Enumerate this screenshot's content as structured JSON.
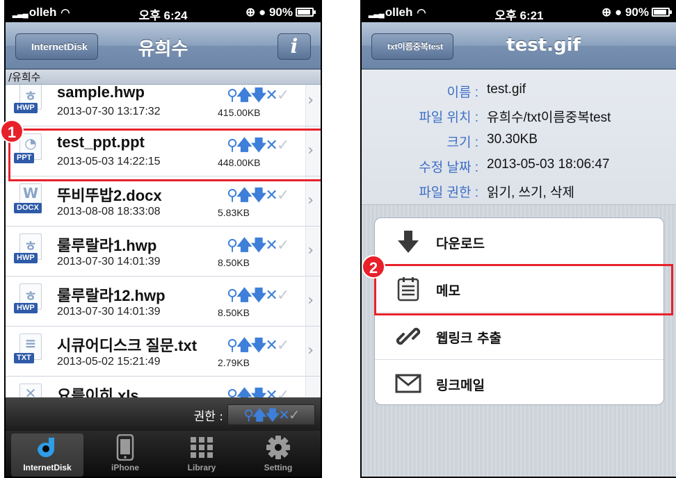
{
  "left": {
    "status": {
      "carrier": "olleh",
      "time": "오후 6:24",
      "battery": "90%"
    },
    "nav": {
      "back": "InternetDisk",
      "title": "유희수",
      "info": "i"
    },
    "path": "/유희수",
    "files": [
      {
        "name": "sample.hwp",
        "date": "2013-07-30 13:17:32",
        "size": "415.00KB",
        "type": "HWP",
        "icon": "hwp-file-icon"
      },
      {
        "name": "test_ppt.ppt",
        "date": "2013-05-03 14:22:15",
        "size": "448.00KB",
        "type": "PPT",
        "icon": "ppt-file-icon"
      },
      {
        "name": "뚜비뚜밥2.docx",
        "date": "2013-08-08 18:33:08",
        "size": "5.83KB",
        "type": "DOCX",
        "icon": "docx-file-icon"
      },
      {
        "name": "룰루랄라1.hwp",
        "date": "2013-07-30 14:01:39",
        "size": "8.50KB",
        "type": "HWP",
        "icon": "hwp-file-icon"
      },
      {
        "name": "룰루랄라12.hwp",
        "date": "2013-07-30 14:01:39",
        "size": "8.50KB",
        "type": "HWP",
        "icon": "hwp-file-icon"
      },
      {
        "name": "시큐어디스크 질문.txt",
        "date": "2013-05-02 15:21:49",
        "size": "2.79KB",
        "type": "TXT",
        "icon": "txt-file-icon"
      },
      {
        "name": "요를이히.xls",
        "date": "",
        "size": "",
        "type": "",
        "icon": "xls-file-icon"
      }
    ],
    "perm_label": "권한 :",
    "tabs": [
      "InternetDisk",
      "iPhone",
      "Library",
      "Setting"
    ],
    "marker": "1"
  },
  "right": {
    "status": {
      "carrier": "olleh",
      "time": "오후 6:21",
      "battery": "90%"
    },
    "nav": {
      "back": "txt이름중복test",
      "title": "test.gif"
    },
    "info": [
      {
        "key": "이름 :",
        "value": "test.gif"
      },
      {
        "key": "파일 위치 :",
        "value": "유희수/txt이름중복test"
      },
      {
        "key": "크기 :",
        "value": "30.30KB"
      },
      {
        "key": "수정 날짜 :",
        "value": "2013-05-03 18:06:47"
      },
      {
        "key": "파일 권한 :",
        "value": "읽기, 쓰기, 삭제"
      }
    ],
    "actions": [
      {
        "label": "다운로드",
        "icon": "download-icon"
      },
      {
        "label": "메모",
        "icon": "memo-icon"
      },
      {
        "label": "웹링크 추출",
        "icon": "link-icon"
      },
      {
        "label": "링크메일",
        "icon": "mail-icon"
      }
    ],
    "marker": "2"
  },
  "colors": {
    "highlight": "#e8202a",
    "accent": "#3d7fd9",
    "label_blue": "#3e6fc6"
  }
}
